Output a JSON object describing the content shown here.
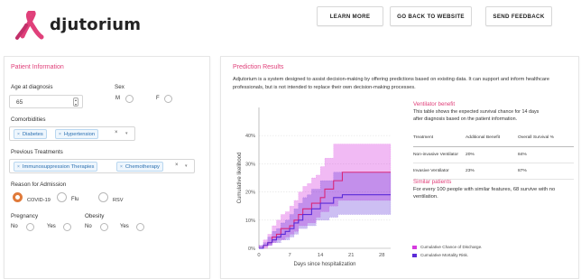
{
  "header": {
    "logo_text": "djutorium",
    "buttons": {
      "learn_more": "LEARN MORE",
      "go_back": "GO BACK TO WEBSITE",
      "send_feedback": "SEND FEEDBACK"
    }
  },
  "patient": {
    "title": "Patient Information",
    "age_label": "Age at diagnosis",
    "age_value": "65",
    "sex_label": "Sex",
    "sex_m": "M",
    "sex_f": "F",
    "comorbidities_label": "Comorbidities",
    "comorbidities": [
      "Diabetes",
      "Hypertension"
    ],
    "previous_label": "Previous Treatments",
    "previous": [
      "Immunosuppression Therapies",
      "Chemotherapy"
    ],
    "reason_label": "Reason for Admission",
    "reasons": [
      "COVID-19",
      "Flu",
      "RSV"
    ],
    "reason_selected": "COVID-19",
    "pregnancy_label": "Pregnancy",
    "obesity_label": "Obesity",
    "no": "No",
    "yes": "Yes",
    "clear_symbol": "×",
    "dropdown_symbol": "▾",
    "tag_remove_symbol": "×"
  },
  "prediction": {
    "title": "Prediction Results",
    "description": "Adjutorium is a system designed to assist decision-making by offering predictions based on existing data. It can support and inform healthcare professionals, but is not intended to replace their own decision-making processes.",
    "ventilator": {
      "title": "Ventilator benefit",
      "text1": "This table shows the expected survival chance for 14 days",
      "text2": "after diagnosis based on the patient information.",
      "headers": [
        "Treatment",
        "Additional Benefit",
        "Overall Survival %"
      ],
      "rows": [
        [
          "Non-invasive Ventilator",
          "20%",
          "84%"
        ],
        [
          "Invasive Ventilator",
          "23%",
          "87%"
        ]
      ]
    },
    "similar": {
      "title": "Similar patients",
      "text1": "For every 100 people with similar features, 68 survive with no",
      "text2": "ventilation."
    },
    "legend": [
      {
        "label": "Cumulative Chance of Discharge.",
        "color": "#d63adf"
      },
      {
        "label": "Cumulative Mortality Risk.",
        "color": "#5b2bd8"
      }
    ]
  },
  "chart_data": {
    "type": "line",
    "xlabel": "Days since hospitalization",
    "ylabel": "Cumulative likelihood",
    "xlim": [
      0,
      30
    ],
    "ylim": [
      0,
      50
    ],
    "xticks": [
      0,
      7,
      14,
      21,
      28
    ],
    "yticks": [
      0,
      10,
      20,
      30,
      40,
      50
    ],
    "ytick_labels": [
      "0%",
      "10%",
      "20%",
      "30%",
      "40%",
      "50%"
    ],
    "series": [
      {
        "name": "Cumulative Chance of Discharge.",
        "color": "#d63adf",
        "x": [
          0,
          1,
          2,
          3,
          4,
          5,
          6,
          7,
          8,
          9,
          10,
          11,
          12,
          13,
          14,
          15,
          16,
          17,
          18,
          19,
          20,
          21,
          22,
          23,
          24,
          25,
          26,
          27,
          28,
          29,
          30
        ],
        "y": [
          0,
          1,
          2,
          4,
          5,
          7,
          7,
          8,
          10,
          12,
          14,
          14,
          16,
          16,
          18,
          21,
          21,
          24,
          24,
          27,
          27,
          27,
          27,
          27,
          27,
          27,
          27,
          27,
          27,
          27,
          27
        ],
        "lower": [
          0,
          0,
          0,
          1,
          2,
          3,
          3,
          4,
          5,
          6,
          8,
          8,
          9,
          9,
          11,
          13,
          13,
          15,
          15,
          17,
          17,
          17,
          17,
          17,
          17,
          17,
          17,
          17,
          17,
          17,
          17
        ],
        "upper": [
          1,
          3,
          5,
          8,
          10,
          12,
          13,
          15,
          17,
          20,
          22,
          23,
          25,
          26,
          29,
          32,
          32,
          37,
          37,
          37,
          37,
          37,
          37,
          37,
          37,
          37,
          37,
          37,
          37,
          37,
          37
        ]
      },
      {
        "name": "Cumulative Mortality Risk.",
        "color": "#5b2bd8",
        "x": [
          0,
          1,
          2,
          3,
          4,
          5,
          6,
          7,
          8,
          9,
          10,
          11,
          12,
          13,
          14,
          15,
          16,
          17,
          18,
          19,
          20,
          21,
          22,
          23,
          24,
          25,
          26,
          27,
          28,
          29,
          30
        ],
        "y": [
          0,
          1,
          2,
          3,
          4,
          5,
          6,
          7,
          9,
          10,
          12,
          12,
          14,
          14,
          16,
          16,
          16,
          18,
          18,
          19,
          19,
          19,
          19,
          19,
          19,
          19,
          19,
          19,
          19,
          19,
          19
        ],
        "lower": [
          0,
          0,
          1,
          1,
          2,
          2,
          3,
          3,
          4,
          5,
          7,
          7,
          8,
          8,
          10,
          10,
          10,
          11,
          11,
          12,
          12,
          12,
          12,
          12,
          12,
          12,
          12,
          12,
          12,
          12,
          12
        ],
        "upper": [
          1,
          2,
          4,
          6,
          7,
          9,
          10,
          12,
          14,
          16,
          18,
          19,
          21,
          21,
          24,
          24,
          24,
          27,
          27,
          27,
          27,
          27,
          27,
          27,
          27,
          27,
          27,
          27,
          27,
          27,
          27
        ]
      }
    ]
  }
}
